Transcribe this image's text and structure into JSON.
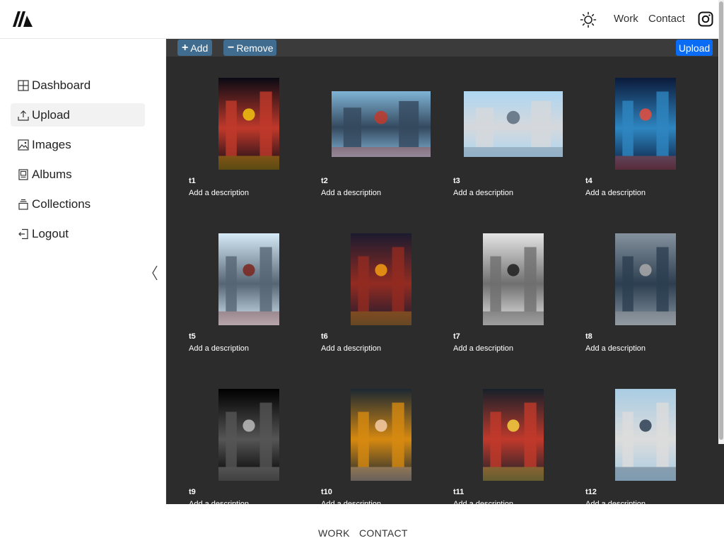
{
  "header": {
    "logo_icon": "m-logo-icon",
    "theme_icon": "sun-icon",
    "nav": [
      "Work",
      "Contact"
    ],
    "social_icon": "instagram-icon"
  },
  "sidebar": {
    "items": [
      {
        "label": "Dashboard",
        "icon": "grid-icon",
        "active": false
      },
      {
        "label": "Upload",
        "icon": "upload-icon",
        "active": true
      },
      {
        "label": "Images",
        "icon": "image-icon",
        "active": false
      },
      {
        "label": "Albums",
        "icon": "album-icon",
        "active": false
      },
      {
        "label": "Collections",
        "icon": "collections-icon",
        "active": false
      },
      {
        "label": "Logout",
        "icon": "logout-icon",
        "active": false
      }
    ],
    "collapse_icon": "chevron-left-icon"
  },
  "toolbar": {
    "add_label": "Add",
    "remove_label": "Remove",
    "upload_label": "Upload",
    "accent_color": "#3f6c8f",
    "upload_color": "#0a6cf5"
  },
  "images": [
    {
      "title": "t1",
      "description": "Add a description",
      "orientation": "portrait",
      "palette": [
        "#0a0a14",
        "#c0392b",
        "#f1c40f"
      ]
    },
    {
      "title": "t2",
      "description": "Add a description",
      "orientation": "landscape",
      "palette": [
        "#7fb3d5",
        "#34495e",
        "#c0392b"
      ]
    },
    {
      "title": "t3",
      "description": "Add a description",
      "orientation": "landscape",
      "palette": [
        "#aed6f1",
        "#d5d8dc",
        "#5d6d7e"
      ]
    },
    {
      "title": "t4",
      "description": "Add a description",
      "orientation": "portrait",
      "palette": [
        "#0b1a3a",
        "#2e86c1",
        "#e74c3c"
      ]
    },
    {
      "title": "t5",
      "description": "Add a description",
      "orientation": "portrait",
      "palette": [
        "#d6eaf8",
        "#566573",
        "#7b241c"
      ]
    },
    {
      "title": "t6",
      "description": "Add a description",
      "orientation": "portrait",
      "palette": [
        "#1b1b2f",
        "#922b21",
        "#f39c12"
      ]
    },
    {
      "title": "t7",
      "description": "Add a description",
      "orientation": "portrait",
      "palette": [
        "#e5e5e5",
        "#6f6f6f",
        "#1e1e1e"
      ]
    },
    {
      "title": "t8",
      "description": "Add a description",
      "orientation": "portrait",
      "palette": [
        "#85929e",
        "#2c3e50",
        "#a9a9a9"
      ]
    },
    {
      "title": "t9",
      "description": "Add a description",
      "orientation": "portrait",
      "palette": [
        "#000000",
        "#555555",
        "#bbbbbb"
      ]
    },
    {
      "title": "t10",
      "description": "Add a description",
      "orientation": "portrait",
      "palette": [
        "#1c2833",
        "#d68910",
        "#f5cba7"
      ]
    },
    {
      "title": "t11",
      "description": "Add a description",
      "orientation": "portrait",
      "palette": [
        "#17202a",
        "#c0392b",
        "#f4d03f"
      ]
    },
    {
      "title": "t12",
      "description": "Add a description",
      "orientation": "portrait",
      "palette": [
        "#a9cce3",
        "#dcdcdc",
        "#2e4053"
      ]
    }
  ],
  "footer": {
    "links": [
      "WORK",
      "CONTACT"
    ]
  }
}
